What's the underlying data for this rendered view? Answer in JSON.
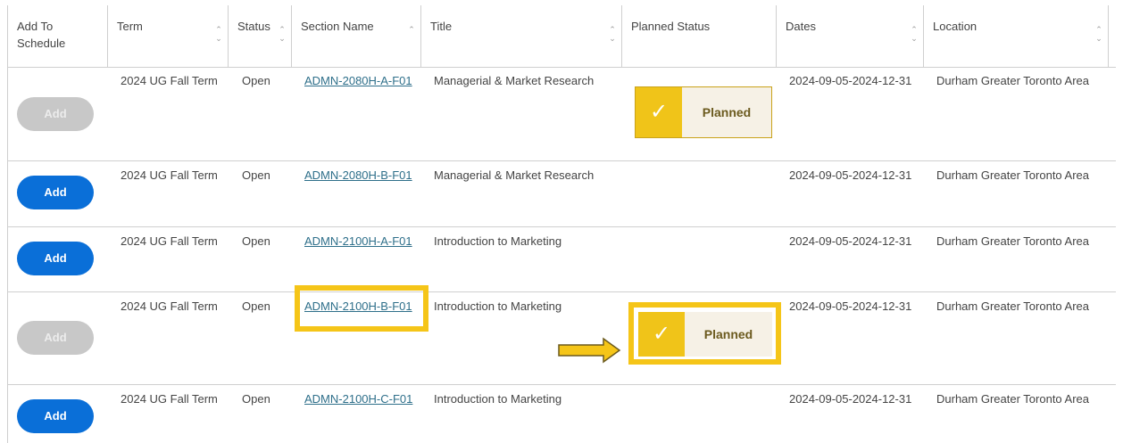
{
  "columns": [
    {
      "label": "Add To Schedule",
      "sortable": false
    },
    {
      "label": "Term",
      "sortable": true
    },
    {
      "label": "Status",
      "sortable": true
    },
    {
      "label": "Section Name",
      "sortable": true
    },
    {
      "label": "Title",
      "sortable": true
    },
    {
      "label": "Planned Status",
      "sortable": false
    },
    {
      "label": "Dates",
      "sortable": true
    },
    {
      "label": "Location",
      "sortable": true
    }
  ],
  "rows": [
    {
      "add_label": "Add",
      "add_enabled": false,
      "term": "2024 UG Fall Term",
      "status": "Open",
      "section": "ADMN-2080H-A-F01",
      "title": "Managerial & Market Research",
      "planned": "Planned",
      "dates": "2024-09-05-2024-12-31",
      "location": "Durham Greater Toronto Area"
    },
    {
      "add_label": "Add",
      "add_enabled": true,
      "term": "2024 UG Fall Term",
      "status": "Open",
      "section": "ADMN-2080H-B-F01",
      "title": "Managerial & Market Research",
      "planned": "",
      "dates": "2024-09-05-2024-12-31",
      "location": "Durham Greater Toronto Area"
    },
    {
      "add_label": "Add",
      "add_enabled": true,
      "term": "2024 UG Fall Term",
      "status": "Open",
      "section": "ADMN-2100H-A-F01",
      "title": "Introduction to Marketing",
      "planned": "",
      "dates": "2024-09-05-2024-12-31",
      "location": "Durham Greater Toronto Area"
    },
    {
      "add_label": "Add",
      "add_enabled": false,
      "term": "2024 UG Fall Term",
      "status": "Open",
      "section": "ADMN-2100H-B-F01",
      "title": "Introduction to Marketing",
      "planned": "Planned",
      "dates": "2024-09-05-2024-12-31",
      "location": "Durham Greater Toronto Area"
    },
    {
      "add_label": "Add",
      "add_enabled": true,
      "term": "2024 UG Fall Term",
      "status": "Open",
      "section": "ADMN-2100H-C-F01",
      "title": "Introduction to Marketing",
      "planned": "",
      "dates": "2024-09-05-2024-12-31",
      "location": "Durham Greater Toronto Area"
    }
  ],
  "colors": {
    "accent_blue": "#0a6fd8",
    "highlight_yellow": "#f5c518",
    "planned_yellow": "#f0c419",
    "link": "#2e6f8a"
  }
}
